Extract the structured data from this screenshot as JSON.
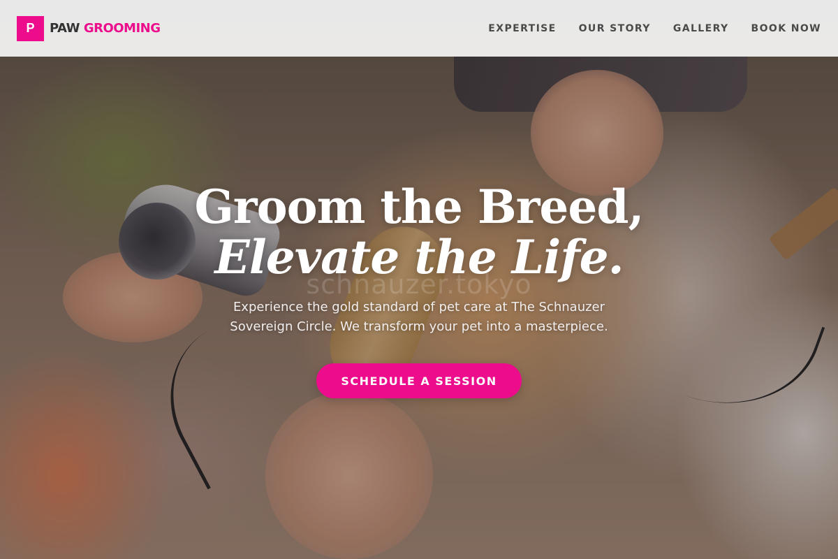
{
  "brand": {
    "mark": "P",
    "name_part1": "PAW",
    "name_part2": "GROOMING",
    "accent_color": "#ec0c8c"
  },
  "nav": {
    "links": [
      {
        "label": "EXPERTISE"
      },
      {
        "label": "OUR STORY"
      },
      {
        "label": "GALLERY"
      },
      {
        "label": "BOOK NOW"
      }
    ]
  },
  "hero": {
    "headline_line1": "Groom the Breed,",
    "headline_line2": "Elevate the Life.",
    "watermark": "schnauzer.tokyo",
    "subtext": "Experience the gold standard of pet care at The Schnauzer Sovereign Circle. We transform your pet into a masterpiece.",
    "cta_label": "SCHEDULE A SESSION"
  }
}
